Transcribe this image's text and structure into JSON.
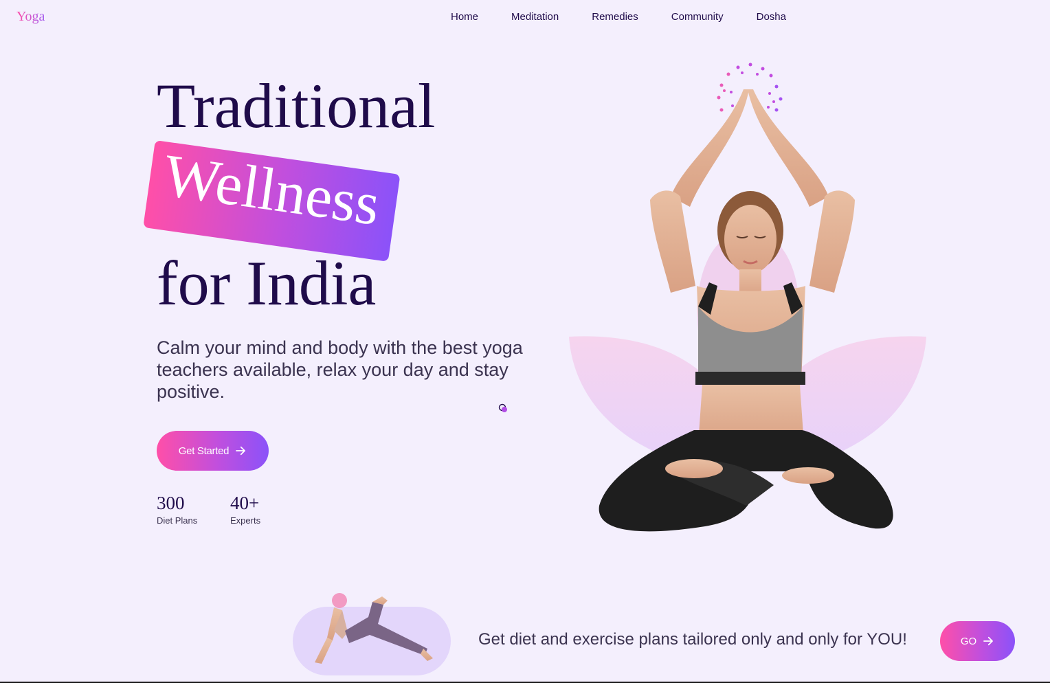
{
  "logo": "Yoga",
  "nav": {
    "items": [
      "Home",
      "Meditation",
      "Remedies",
      "Community",
      "Dosha"
    ]
  },
  "hero": {
    "line1": "Traditional",
    "highlight": "Wellness",
    "line3": "for India",
    "subtitle": "Calm your mind and body with the best yoga teachers available, relax your day and stay positive.",
    "cta_label": "Get Started",
    "cta_icon": "arrow-right-icon"
  },
  "stats": [
    {
      "value": "300",
      "label": "Diet Plans"
    },
    {
      "value": "40+",
      "label": "Experts"
    }
  ],
  "banner": {
    "text": "Get diet and exercise plans tailored only and only for YOU!",
    "button_label": "GO",
    "button_icon": "arrow-right-icon"
  },
  "colors": {
    "background": "#f4effd",
    "heading": "#1f0b4a",
    "gradient_start": "#ff4fa8",
    "gradient_end": "#8b52f9",
    "pill": "#e3d6fb"
  }
}
